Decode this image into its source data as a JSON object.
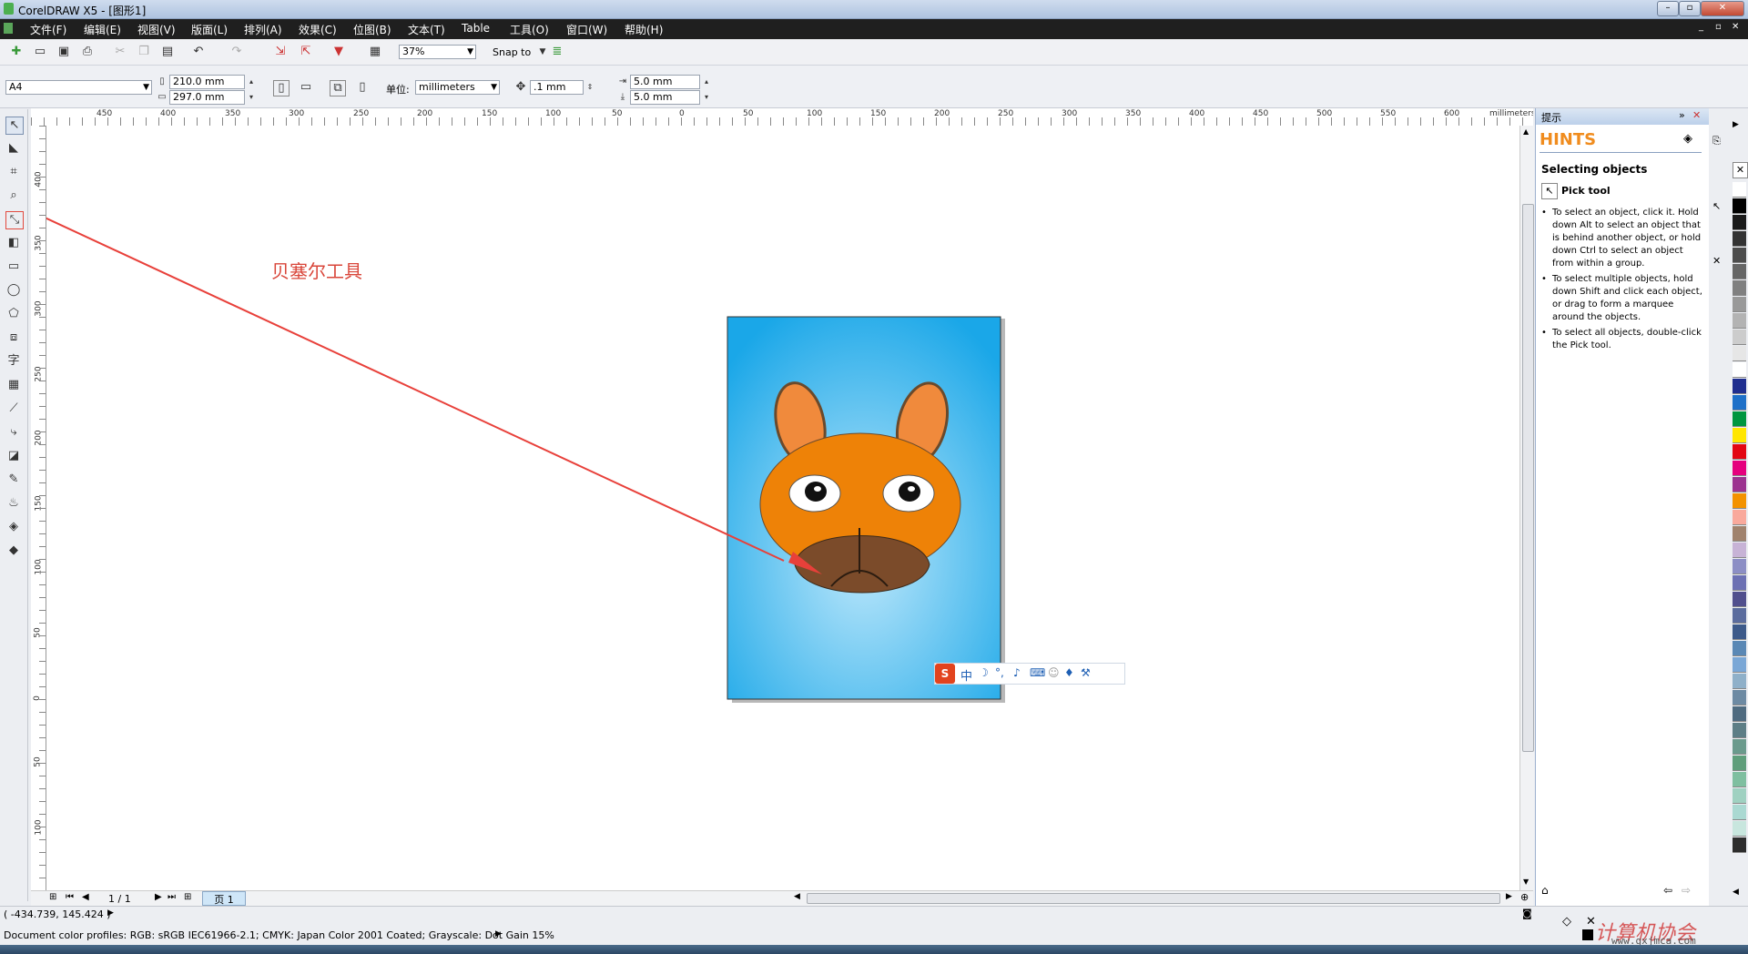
{
  "window": {
    "title": "CorelDRAW X5 - [图形1]"
  },
  "menu": [
    "文件(F)",
    "编辑(E)",
    "视图(V)",
    "版面(L)",
    "排列(A)",
    "效果(C)",
    "位图(B)",
    "文本(T)",
    "Table",
    "工具(O)",
    "窗口(W)",
    "帮助(H)"
  ],
  "toolbar": {
    "zoom": "37%",
    "snap": "Snap to"
  },
  "properties": {
    "page_size": "A4",
    "width": "210.0 mm",
    "height": "297.0 mm",
    "units_label": "单位:",
    "units": "millimeters",
    "nudge": ".1 mm",
    "dup_x": "5.0 mm",
    "dup_y": "5.0 mm"
  },
  "ruler": {
    "unit": "millimeters",
    "h_ticks": [
      "450",
      "400",
      "350",
      "300",
      "250",
      "200",
      "150",
      "100",
      "50",
      "0",
      "50",
      "100",
      "150",
      "200",
      "250",
      "300",
      "350",
      "400",
      "450",
      "500",
      "550",
      "600"
    ],
    "v_ticks": [
      "400",
      "350",
      "300",
      "250",
      "200",
      "150",
      "100",
      "50",
      "0",
      "50",
      "100"
    ]
  },
  "annotation": {
    "label": "贝塞尔工具"
  },
  "page_nav": {
    "count": "1 / 1",
    "tab": "页 1"
  },
  "docker": {
    "panel_title": "提示",
    "heading": "HINTS",
    "section": "Selecting objects",
    "tool": "Pick tool",
    "bullets": [
      "To select an object, click it. Hold down Alt to select an object that is behind another object, or hold down Ctrl to select an object from within a group.",
      "To select multiple objects, hold down Shift and click each object, or drag to form a marquee around the objects.",
      "To select all objects, double-click the Pick tool."
    ]
  },
  "ime_bar": {
    "mode": "中"
  },
  "status": {
    "coords": "( -434.739, 145.424 )",
    "profiles": "Document color profiles: RGB: sRGB IEC61966-2.1; CMYK: Japan Color 2001 Coated; Grayscale: Dot Gain 15%"
  },
  "watermark": {
    "text": "计算机协会",
    "url": "www.gxjmca.com"
  },
  "colors": {
    "menubar": "#1f1f1f",
    "bg_top": "#1aa7e8",
    "bg_center": "#bfe8fb",
    "head": "#ee8207",
    "ears": "#f08a3c",
    "muzzle": "#7b4b2a",
    "arrow": "#e8403a",
    "hints": "#f08c1e"
  },
  "palette": [
    "#ffffff",
    "#000000",
    "#1a1a1a",
    "#333333",
    "#4d4d4d",
    "#666666",
    "#808080",
    "#999999",
    "#b3b3b3",
    "#cccccc",
    "#e6e6e6",
    "#ffffff",
    "#1f2e8f",
    "#1e70c8",
    "#00963f",
    "#ffe600",
    "#e30613",
    "#e5007e",
    "#9c3390",
    "#f39200",
    "#f9a99c",
    "#a0826d",
    "#c7b3d6",
    "#8c8ec5",
    "#6c70b3",
    "#514f8d",
    "#5b6c9e",
    "#3d5a8a",
    "#5a88b5",
    "#7aa7d6",
    "#8fb0c9",
    "#6d8aa3",
    "#4f6b80",
    "#5d7e86",
    "#6a9a8c",
    "#5f9e7b",
    "#7fbfa0",
    "#9fd1c1",
    "#aad9d2",
    "#c8e6de",
    "#2d2d2d"
  ]
}
